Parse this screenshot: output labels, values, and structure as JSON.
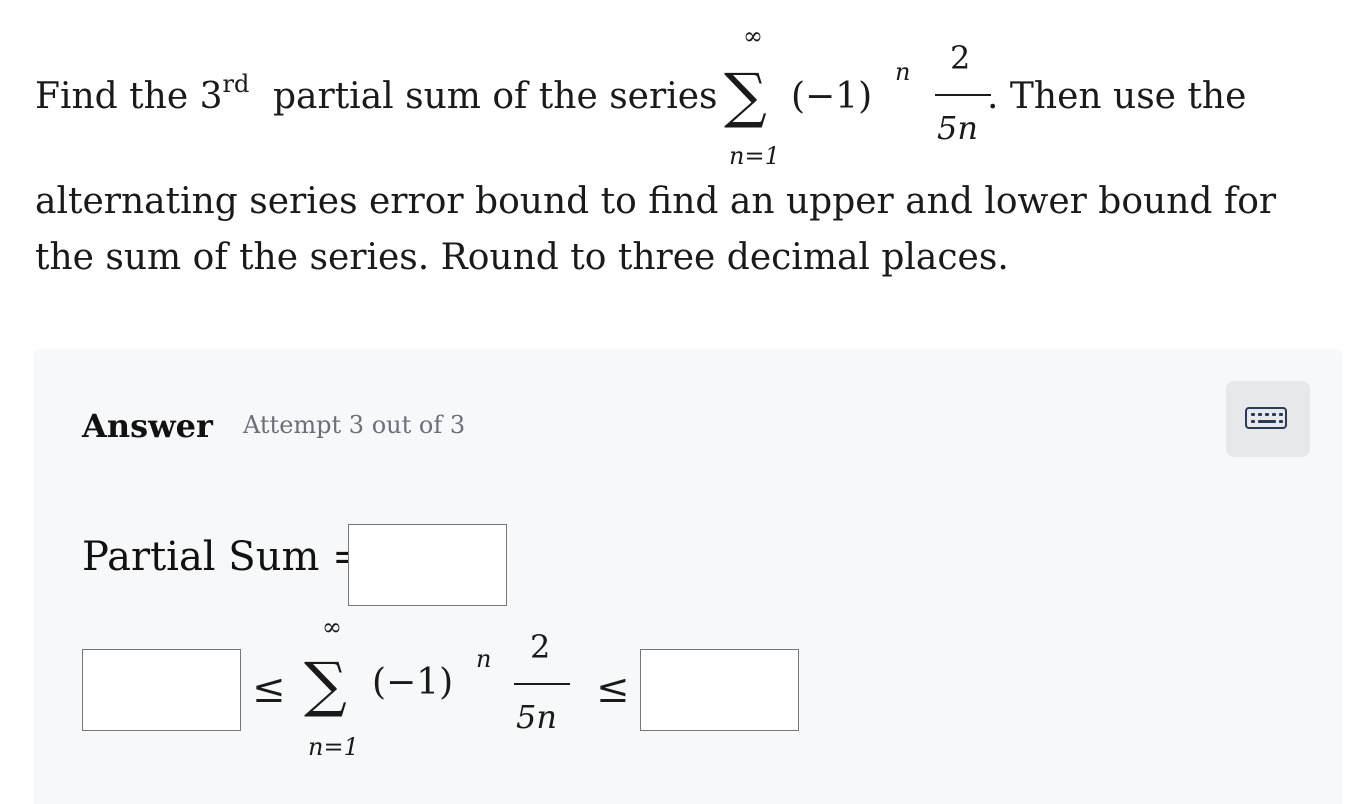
{
  "question": {
    "text_find": "Find the 3",
    "text_ordinal": "rd",
    "text_partial": "partial sum of the series",
    "sum_upper": "∞",
    "sum_symbol": "∑",
    "sum_lower": "n=1",
    "term": "(−1)",
    "term_exp": "n",
    "frac_num": "2",
    "frac_den": "5n",
    "text_then": ". Then use the",
    "line2": "alternating series error bound to find an upper and lower bound for",
    "line3": "the sum of the series. Round to three decimal places."
  },
  "answer": {
    "label": "Answer",
    "attempt": "Attempt 3 out of 3",
    "keyboard_icon": "keyboard-icon",
    "partial_sum_label": "Partial Sum =",
    "partial_sum_value": "",
    "lower_bound_value": "",
    "upper_bound_value": "",
    "leq": "≤",
    "sum_upper": "∞",
    "sum_symbol": "∑",
    "sum_lower": "n=1",
    "term": "(−1)",
    "term_exp": "n",
    "frac_num": "2",
    "frac_den": "5n"
  }
}
